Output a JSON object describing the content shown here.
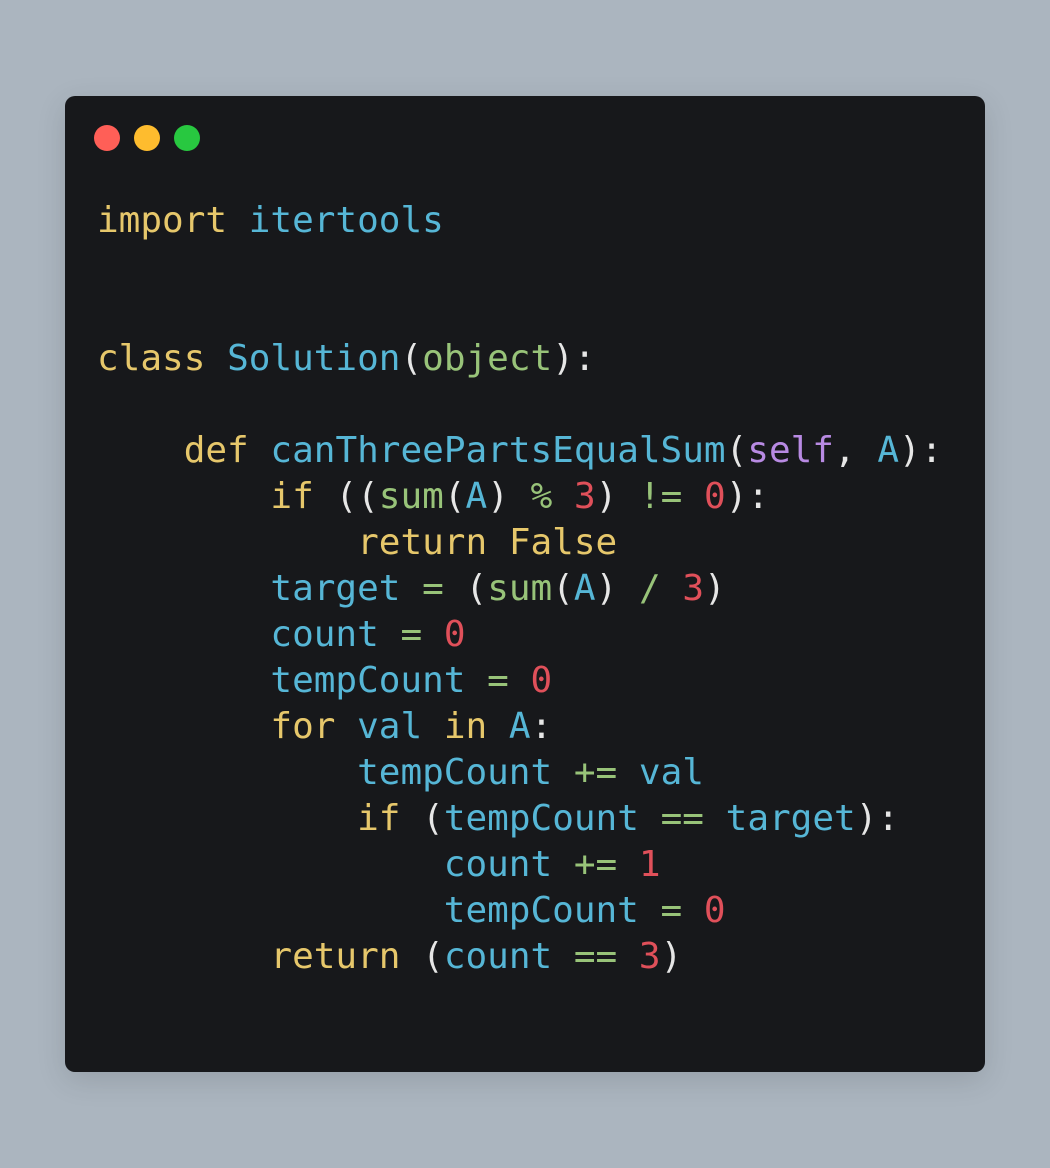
{
  "window": {
    "traffic_lights": [
      {
        "name": "close",
        "color": "#ff5f57"
      },
      {
        "name": "minimize",
        "color": "#febc2e"
      },
      {
        "name": "zoom",
        "color": "#28c840"
      }
    ]
  },
  "colors": {
    "background": "#abb5bf",
    "editor": "#17181b",
    "keyword": "#e6c76b",
    "name": "#56b6d6",
    "builtin": "#98c379",
    "self": "#b88ae3",
    "number": "#e0505a",
    "punctuation": "#e6e6e6"
  },
  "code": {
    "lines": [
      [
        {
          "t": "kw",
          "v": "import"
        },
        {
          "t": "ws",
          "v": " "
        },
        {
          "t": "name",
          "v": "itertools"
        }
      ],
      [],
      [],
      [
        {
          "t": "kw",
          "v": "class"
        },
        {
          "t": "ws",
          "v": " "
        },
        {
          "t": "name",
          "v": "Solution"
        },
        {
          "t": "punc",
          "v": "("
        },
        {
          "t": "builtin",
          "v": "object"
        },
        {
          "t": "punc",
          "v": "):"
        }
      ],
      [],
      [
        {
          "t": "ws",
          "v": "    "
        },
        {
          "t": "kw",
          "v": "def"
        },
        {
          "t": "ws",
          "v": " "
        },
        {
          "t": "name",
          "v": "canThreePartsEqualSum"
        },
        {
          "t": "punc",
          "v": "("
        },
        {
          "t": "self",
          "v": "self"
        },
        {
          "t": "punc",
          "v": ", "
        },
        {
          "t": "name",
          "v": "A"
        },
        {
          "t": "punc",
          "v": "):"
        }
      ],
      [
        {
          "t": "ws",
          "v": "        "
        },
        {
          "t": "kw",
          "v": "if"
        },
        {
          "t": "ws",
          "v": " "
        },
        {
          "t": "punc",
          "v": "(("
        },
        {
          "t": "builtin",
          "v": "sum"
        },
        {
          "t": "punc",
          "v": "("
        },
        {
          "t": "name",
          "v": "A"
        },
        {
          "t": "punc",
          "v": ") "
        },
        {
          "t": "op",
          "v": "%"
        },
        {
          "t": "ws",
          "v": " "
        },
        {
          "t": "num",
          "v": "3"
        },
        {
          "t": "punc",
          "v": ") "
        },
        {
          "t": "op",
          "v": "!="
        },
        {
          "t": "ws",
          "v": " "
        },
        {
          "t": "num",
          "v": "0"
        },
        {
          "t": "punc",
          "v": "):"
        }
      ],
      [
        {
          "t": "ws",
          "v": "            "
        },
        {
          "t": "kw",
          "v": "return"
        },
        {
          "t": "ws",
          "v": " "
        },
        {
          "t": "kw",
          "v": "False"
        }
      ],
      [
        {
          "t": "ws",
          "v": "        "
        },
        {
          "t": "name",
          "v": "target"
        },
        {
          "t": "ws",
          "v": " "
        },
        {
          "t": "op",
          "v": "="
        },
        {
          "t": "ws",
          "v": " "
        },
        {
          "t": "punc",
          "v": "("
        },
        {
          "t": "builtin",
          "v": "sum"
        },
        {
          "t": "punc",
          "v": "("
        },
        {
          "t": "name",
          "v": "A"
        },
        {
          "t": "punc",
          "v": ") "
        },
        {
          "t": "op",
          "v": "/"
        },
        {
          "t": "ws",
          "v": " "
        },
        {
          "t": "num",
          "v": "3"
        },
        {
          "t": "punc",
          "v": ")"
        }
      ],
      [
        {
          "t": "ws",
          "v": "        "
        },
        {
          "t": "name",
          "v": "count"
        },
        {
          "t": "ws",
          "v": " "
        },
        {
          "t": "op",
          "v": "="
        },
        {
          "t": "ws",
          "v": " "
        },
        {
          "t": "num",
          "v": "0"
        }
      ],
      [
        {
          "t": "ws",
          "v": "        "
        },
        {
          "t": "name",
          "v": "tempCount"
        },
        {
          "t": "ws",
          "v": " "
        },
        {
          "t": "op",
          "v": "="
        },
        {
          "t": "ws",
          "v": " "
        },
        {
          "t": "num",
          "v": "0"
        }
      ],
      [
        {
          "t": "ws",
          "v": "        "
        },
        {
          "t": "kw",
          "v": "for"
        },
        {
          "t": "ws",
          "v": " "
        },
        {
          "t": "name",
          "v": "val"
        },
        {
          "t": "ws",
          "v": " "
        },
        {
          "t": "kw",
          "v": "in"
        },
        {
          "t": "ws",
          "v": " "
        },
        {
          "t": "name",
          "v": "A"
        },
        {
          "t": "punc",
          "v": ":"
        }
      ],
      [
        {
          "t": "ws",
          "v": "            "
        },
        {
          "t": "name",
          "v": "tempCount"
        },
        {
          "t": "ws",
          "v": " "
        },
        {
          "t": "op",
          "v": "+="
        },
        {
          "t": "ws",
          "v": " "
        },
        {
          "t": "name",
          "v": "val"
        }
      ],
      [
        {
          "t": "ws",
          "v": "            "
        },
        {
          "t": "kw",
          "v": "if"
        },
        {
          "t": "ws",
          "v": " "
        },
        {
          "t": "punc",
          "v": "("
        },
        {
          "t": "name",
          "v": "tempCount"
        },
        {
          "t": "ws",
          "v": " "
        },
        {
          "t": "op",
          "v": "=="
        },
        {
          "t": "ws",
          "v": " "
        },
        {
          "t": "name",
          "v": "target"
        },
        {
          "t": "punc",
          "v": "):"
        }
      ],
      [
        {
          "t": "ws",
          "v": "                "
        },
        {
          "t": "name",
          "v": "count"
        },
        {
          "t": "ws",
          "v": " "
        },
        {
          "t": "op",
          "v": "+="
        },
        {
          "t": "ws",
          "v": " "
        },
        {
          "t": "num",
          "v": "1"
        }
      ],
      [
        {
          "t": "ws",
          "v": "                "
        },
        {
          "t": "name",
          "v": "tempCount"
        },
        {
          "t": "ws",
          "v": " "
        },
        {
          "t": "op",
          "v": "="
        },
        {
          "t": "ws",
          "v": " "
        },
        {
          "t": "num",
          "v": "0"
        }
      ],
      [
        {
          "t": "ws",
          "v": "        "
        },
        {
          "t": "kw",
          "v": "return"
        },
        {
          "t": "ws",
          "v": " "
        },
        {
          "t": "punc",
          "v": "("
        },
        {
          "t": "name",
          "v": "count"
        },
        {
          "t": "ws",
          "v": " "
        },
        {
          "t": "op",
          "v": "=="
        },
        {
          "t": "ws",
          "v": " "
        },
        {
          "t": "num",
          "v": "3"
        },
        {
          "t": "punc",
          "v": ")"
        }
      ]
    ]
  }
}
